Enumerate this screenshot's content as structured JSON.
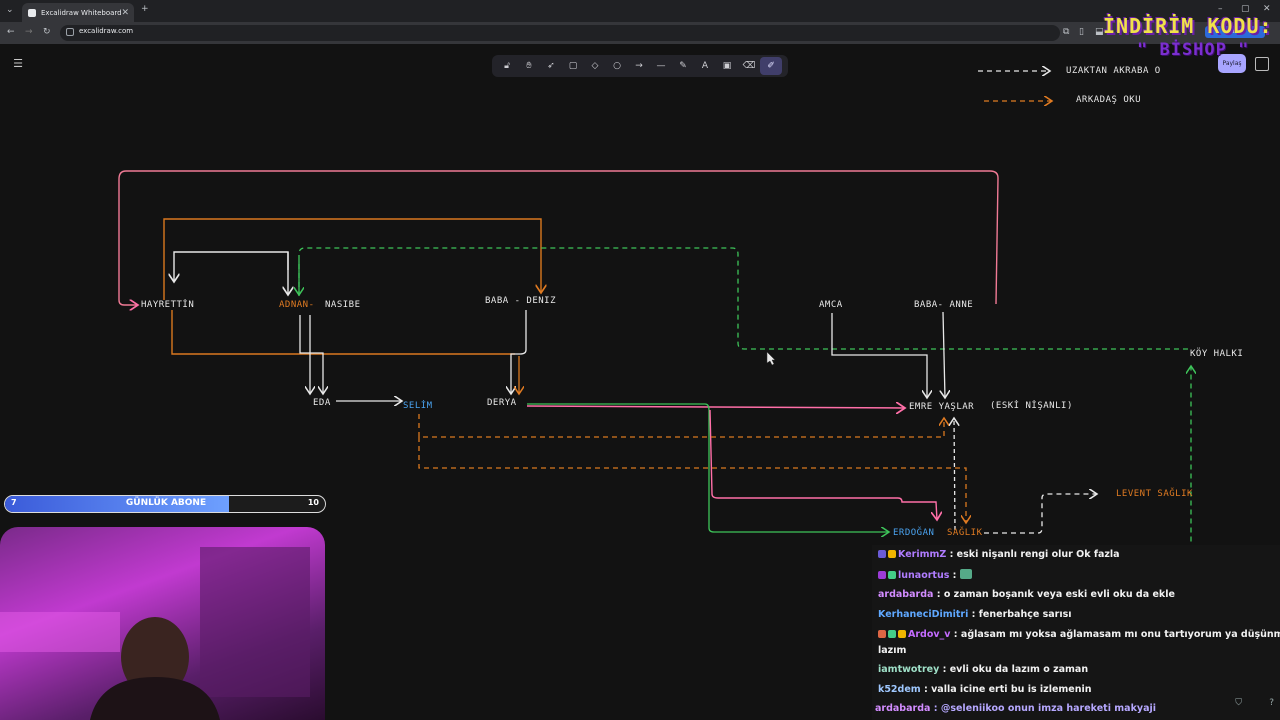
{
  "browser": {
    "tab_title": "Excalidraw Whiteboard",
    "url": "excalidraw.com"
  },
  "canvas": {
    "labels": {
      "hayrettin": "HAYRETTİN",
      "adnan": "ADNAN-",
      "nasibe": "NASIBE",
      "baba_deniz": "BABA - DENIZ",
      "amca": "AMCA",
      "baba_anne": "BABA- ANNE",
      "eda": "EDA",
      "selim": "SELİM",
      "derya": "DERYA",
      "emre": "EMRE YAŞLAR",
      "eski_nisanli": "(ESKİ NİŞANLI)",
      "koy_halki": "KÖY HALKI",
      "erdogan": "ERDOĞAN",
      "saglik": "SAĞLIK",
      "levent_saglik": "LEVENT SAĞLIK"
    },
    "legend": {
      "uzaktan": "UZAKTAN AKRABA O",
      "arkadas": "ARKADAŞ OKU"
    }
  },
  "toolbar": {
    "share_label": "Paylaş",
    "tools": [
      "lock-icon",
      "hand-icon",
      "selection-icon",
      "rectangle-icon",
      "diamond-icon",
      "ellipse-icon",
      "arrow-icon",
      "line-icon",
      "pencil-icon",
      "text-icon",
      "image-icon",
      "eraser-icon",
      "laser-icon"
    ]
  },
  "overlay": {
    "promo_line1": "İNDİRİM KODU:",
    "promo_line2": "\" BİSHOP \"",
    "sub_bar": {
      "current": "7",
      "label": "GÜNLÜK ABONE",
      "goal": "10",
      "progress": 0.7
    }
  },
  "chat": {
    "messages": [
      {
        "user": "KerimmZ",
        "user_color": "#b07cff",
        "text": " : eski nişanlı rengi olur Ok fazla"
      },
      {
        "user": "lunaortus",
        "user_color": "#b07cff",
        "text": " : "
      },
      {
        "user": "ardabarda",
        "user_color": "#d28cff",
        "text": " : o zaman boşanık veya eski evli oku da ekle"
      },
      {
        "user": "KerhaneciDimitri",
        "user_color": "#5fa8ff",
        "text": " : fenerbahçe sarısı"
      },
      {
        "user": "Ardov_v",
        "user_color": "#c46bff",
        "text": " : ağlasam mı yoksa ağlamasam mı onu tartıyorum ya düşünmem"
      },
      {
        "user": "",
        "user_color": "#f2f2f2",
        "text": "lazım"
      },
      {
        "user": "iamtwotrey",
        "user_color": "#9fe0c8",
        "text": " : evli oku da lazım o zaman"
      },
      {
        "user": "k52dem",
        "user_color": "#9fc8ff",
        "text": " : valla icine erti bu is izlemenin"
      },
      {
        "user": "ardabarda",
        "user_color": "#d28cff",
        "text": " : @seleniikoo onun imza hareketi makyaji"
      }
    ]
  }
}
